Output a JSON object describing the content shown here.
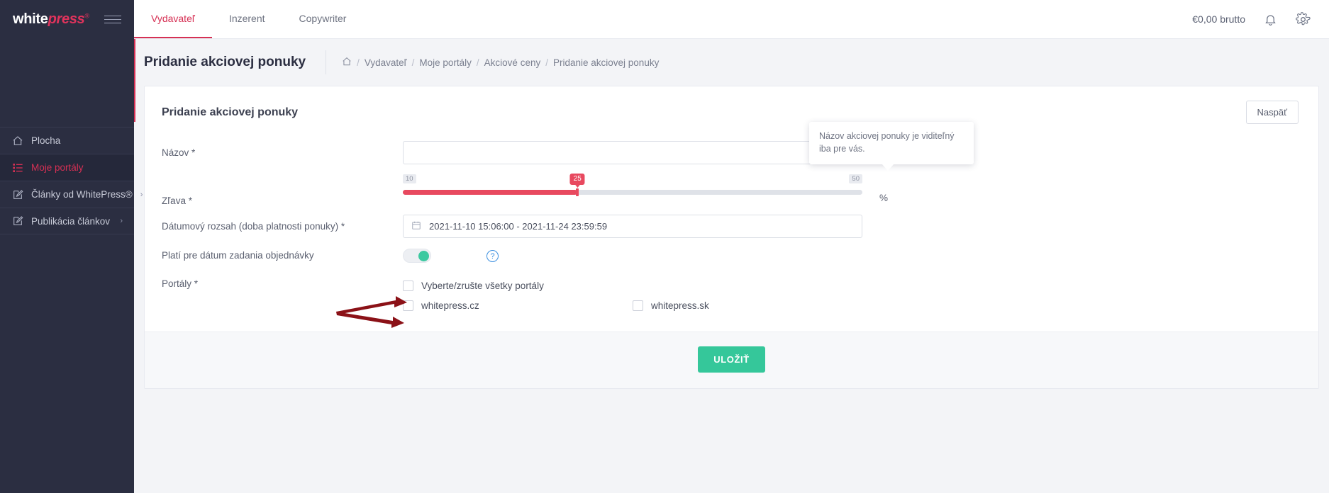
{
  "sidebar": {
    "logo": {
      "part1": "white",
      "part2": "press",
      "reg": "®"
    },
    "items": [
      {
        "label": "Plocha",
        "icon": "home-icon",
        "active": false,
        "caret": ""
      },
      {
        "label": "Moje portály",
        "icon": "list-icon",
        "active": true,
        "caret": ""
      },
      {
        "label": "Články od WhitePress®",
        "icon": "edit-icon",
        "active": false,
        "caret": "›"
      },
      {
        "label": "Publikácia článkov",
        "icon": "edit-icon",
        "active": false,
        "caret": "›"
      }
    ]
  },
  "topbar": {
    "tabs": [
      {
        "label": "Vydavateľ",
        "active": true
      },
      {
        "label": "Inzerent",
        "active": false
      },
      {
        "label": "Copywriter",
        "active": false
      }
    ],
    "balance": "€0,00 brutto",
    "bell_icon": "bell-icon",
    "gear_icon": "gear-icon"
  },
  "page": {
    "title": "Pridanie akciovej ponuky",
    "breadcrumb": {
      "home_icon": "home-icon",
      "items": [
        "Vydavateľ",
        "Moje portály",
        "Akciové ceny",
        "Pridanie akciovej ponuky"
      ],
      "separator": "/"
    }
  },
  "card": {
    "title": "Pridanie akciovej ponuky",
    "back_button": "Naspäť",
    "save_button": "ULOŽIŤ"
  },
  "tooltip": {
    "text": "Názov akciovej ponuky je viditeľný iba pre vás."
  },
  "form": {
    "name": {
      "label": "Názov *",
      "value": "",
      "placeholder": "",
      "help_icon": "question-circle-icon"
    },
    "discount": {
      "label": "Zľava *",
      "min": "10",
      "max": "50",
      "value": "25",
      "unit": "%",
      "fill_percent": 38
    },
    "daterange": {
      "label": "Dátumový rozsah (doba platnosti ponuky) *",
      "value": "2021-11-10 15:06:00 - 2021-11-24 23:59:59",
      "calendar_icon": "calendar-icon"
    },
    "order_date": {
      "label": "Platí pre dátum zadania objednávky",
      "toggle_on": true,
      "help_icon": "question-circle-icon"
    },
    "portals": {
      "label": "Portály *",
      "select_all_label": "Vyberte/zrušte všetky portály",
      "select_all_checked": false,
      "items": [
        {
          "label": "whitepress.cz",
          "checked": false
        },
        {
          "label": "whitepress.sk",
          "checked": false
        }
      ]
    }
  },
  "colors": {
    "accent": "#d63054",
    "sidebar": "#2b2e41",
    "slider": "#e8495f",
    "toggle_on": "#3cc9a0",
    "save": "#35c79a",
    "annotation": "#8b1117"
  }
}
